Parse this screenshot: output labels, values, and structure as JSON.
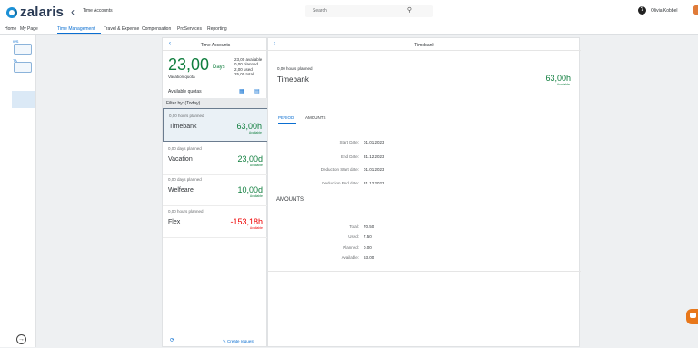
{
  "header": {
    "logo_text": "zalaris",
    "app_title": "Time Accounts",
    "search_placeholder": "Search",
    "user_name": "Olivia Kobbel"
  },
  "menu": {
    "items": [
      "Home",
      "My Page",
      "Time Management",
      "Travel & Expense",
      "Compensation",
      "ProServices",
      "Reporting"
    ],
    "active": "Time Management"
  },
  "sidenav": {
    "tiles": [
      "WS",
      "TA"
    ]
  },
  "left_panel": {
    "title": "Time Accounts",
    "big_number": "23,00",
    "big_unit": "Days",
    "quota_label": "Vacation quota",
    "stats": [
      "23,00 available",
      "0,00 planned",
      "2,00 used",
      "25,00 total"
    ],
    "available_quotas_label": "Available quotas",
    "filter_text": "Filter by: (Today)",
    "quotas": [
      {
        "planned": "0,00 hours planned",
        "name": "Timebank",
        "value": "63,00h",
        "sub": "Available",
        "color": "green"
      },
      {
        "planned": "0,00 days planned",
        "name": "Vacation",
        "value": "23,00d",
        "sub": "Available",
        "color": "green"
      },
      {
        "planned": "0,00 days planned",
        "name": "Welfeare",
        "value": "10,00d",
        "sub": "Available",
        "color": "green"
      },
      {
        "planned": "0,00 hours planned",
        "name": "Flex",
        "value": "-153,18h",
        "sub": "Available",
        "color": "red"
      }
    ],
    "create_request": "Create request"
  },
  "right_panel": {
    "title": "Timebank",
    "planned": "0,00 hours planned",
    "name": "Timebank",
    "value": "63,00h",
    "available_label": "Available",
    "tabs": [
      "PERIOD",
      "AMOUNTS"
    ],
    "period_fields": [
      {
        "label": "Start Date:",
        "value": "01.01.2023"
      },
      {
        "label": "End Date:",
        "value": "31.12.2023"
      },
      {
        "label": "Deduction Start date:",
        "value": "01.01.2023"
      },
      {
        "label": "Deduction End date:",
        "value": "31.12.2023"
      }
    ],
    "amounts_title": "AMOUNTS",
    "amount_fields": [
      {
        "label": "Total:",
        "value": "70.50"
      },
      {
        "label": "Used:",
        "value": "7.50"
      },
      {
        "label": "Planned:",
        "value": "0.00"
      },
      {
        "label": "Available:",
        "value": "63.00"
      }
    ]
  }
}
